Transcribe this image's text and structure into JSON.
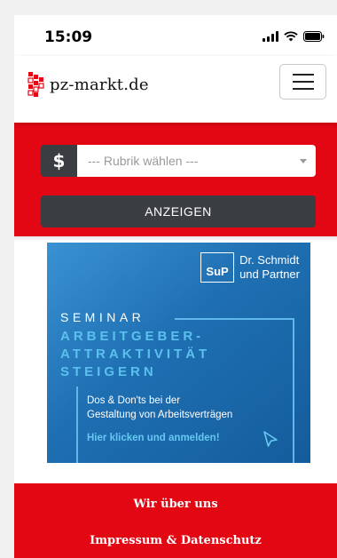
{
  "status_bar": {
    "time": "15:09"
  },
  "header": {
    "logo_text": "pz-markt.de",
    "menu_icon": "hamburger-icon"
  },
  "search": {
    "addon_symbol": "$",
    "rubrik_placeholder": "--- Rubrik wählen ---",
    "show_button": "ANZEIGEN"
  },
  "ad": {
    "brand_short": "SuP",
    "brand_line1": "Dr. Schmidt",
    "brand_line2": "und Partner",
    "seminar": "SEMINAR",
    "headline": [
      "ARBEITGEBER-",
      "ATTRAKTIVITÄT",
      "STEIGERN"
    ],
    "sub_line1": "Dos & Don'ts bei der",
    "sub_line2": "Gestaltung von Arbeitsverträgen",
    "cta": "Hier klicken und anmelden!"
  },
  "footer": {
    "about": "Wir über uns",
    "imprint": "Impressum & Datenschutz"
  },
  "colors": {
    "brand_red": "#e30613",
    "dark_gray": "#3a3d41",
    "ad_blue": "#1e6fb2"
  }
}
